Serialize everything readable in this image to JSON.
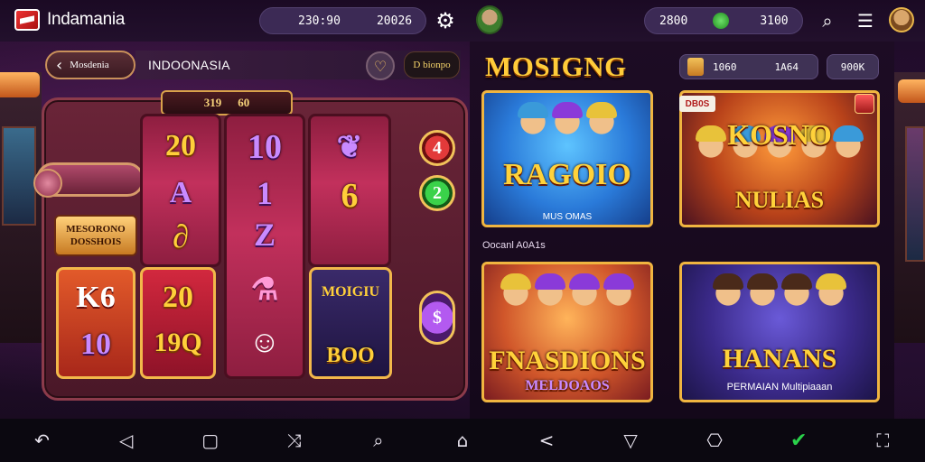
{
  "header": {
    "app_title": "Indamania",
    "balance_1": "230:90",
    "balance_2": "20026",
    "stat_1": "2800",
    "stat_2": "3100"
  },
  "slot": {
    "back_label": "Mosdenia",
    "region_label": "INDOONASIA",
    "tag_label": "D bionpo",
    "top_plaque": [
      "319",
      "60"
    ],
    "reel1": [
      "20",
      "A",
      "∂"
    ],
    "reel2": [
      "10",
      "1",
      "Z"
    ],
    "reel3": [
      "6",
      "6"
    ],
    "lamps": [
      "4",
      "2",
      "$"
    ],
    "side_sign": [
      "MESORONO",
      "DOSSHOIS"
    ],
    "tile_a": [
      "K6",
      "10"
    ],
    "tile_b": [
      "20",
      "19Q"
    ],
    "tile_c": [
      "MOIGIU",
      "BOO"
    ]
  },
  "games_section": {
    "title": "MOSIGNG",
    "chip_values": [
      "1060",
      "1A64"
    ],
    "chip_small": "900K",
    "row_caption": "Oocanl A0A1s",
    "cards": [
      {
        "title": "RAGOIO",
        "subtitle": "MUS OMAS"
      },
      {
        "title": "KOSNO",
        "subtitle": "NULIAS",
        "badge": "DB0S"
      },
      {
        "title": "FNASDIONS",
        "subtitle": "MELDOAOS"
      },
      {
        "title": "HANANS",
        "subtitle": "PERMAIAN Multipiaaan"
      }
    ]
  },
  "bottom_nav": {
    "items": [
      "back",
      "previous",
      "square",
      "shuffle",
      "search",
      "home",
      "share",
      "diamond",
      "gamepad",
      "check",
      "fullscreen"
    ]
  }
}
